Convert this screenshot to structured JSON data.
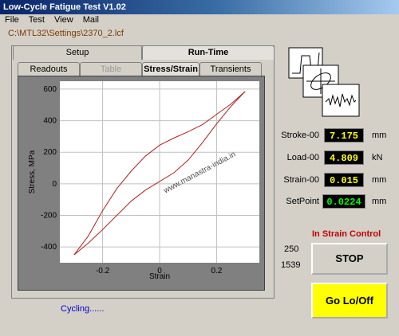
{
  "window": {
    "title": "Low-Cycle Fatigue Test  V1.02"
  },
  "menu": [
    "File",
    "Test",
    "View",
    "Mail"
  ],
  "filepath": "C:\\MTL32\\Settings\\2370_2.lcf",
  "tabs_top": [
    "Setup",
    "Run-Time"
  ],
  "tabs_sub": [
    "Readouts",
    "Table",
    "Stress/Strain",
    "Transients"
  ],
  "watermark": "www.manastra-india.in",
  "chart_data": {
    "type": "line",
    "xlabel": "Strain",
    "ylabel": "Stress, MPa",
    "xlim": [
      -0.35,
      0.35
    ],
    "ylim": [
      -500,
      650
    ],
    "xticks": [
      -0.2,
      0,
      0.2
    ],
    "yticks": [
      -400,
      -200,
      0,
      200,
      400,
      600
    ],
    "grid": true,
    "series": [
      {
        "points": [
          [
            -0.3,
            -450
          ],
          [
            -0.25,
            -375
          ],
          [
            -0.2,
            -290
          ],
          [
            -0.15,
            -200
          ],
          [
            -0.1,
            -110
          ],
          [
            -0.05,
            -40
          ],
          [
            0,
            15
          ],
          [
            0.05,
            70
          ],
          [
            0.1,
            150
          ],
          [
            0.15,
            260
          ],
          [
            0.2,
            380
          ],
          [
            0.25,
            490
          ],
          [
            0.3,
            585
          ]
        ]
      },
      {
        "points": [
          [
            0.3,
            585
          ],
          [
            0.25,
            505
          ],
          [
            0.2,
            440
          ],
          [
            0.15,
            375
          ],
          [
            0.1,
            330
          ],
          [
            0.05,
            290
          ],
          [
            0,
            245
          ],
          [
            -0.05,
            175
          ],
          [
            -0.1,
            80
          ],
          [
            -0.15,
            -30
          ],
          [
            -0.2,
            -170
          ],
          [
            -0.25,
            -330
          ],
          [
            -0.3,
            -450
          ]
        ]
      }
    ],
    "tick_labels_x": [
      "-0.2",
      "0",
      "0.2"
    ],
    "tick_labels_y": [
      "600",
      "400",
      "200",
      "0",
      "-200",
      "-400"
    ]
  },
  "readings": [
    {
      "label": "Stroke-00",
      "value": "7.175",
      "unit": "mm"
    },
    {
      "label": "Load-00",
      "value": "4.809",
      "unit": "kN"
    },
    {
      "label": "Strain-00",
      "value": "0.015",
      "unit": "mm"
    },
    {
      "label": "SetPoint",
      "value": "0.0224",
      "unit": "mm"
    }
  ],
  "control_mode": "In Strain Control",
  "counters": [
    "250",
    "1539"
  ],
  "buttons": {
    "stop": "STOP",
    "go": "Go Lo/Off"
  },
  "status": "Cycling......"
}
